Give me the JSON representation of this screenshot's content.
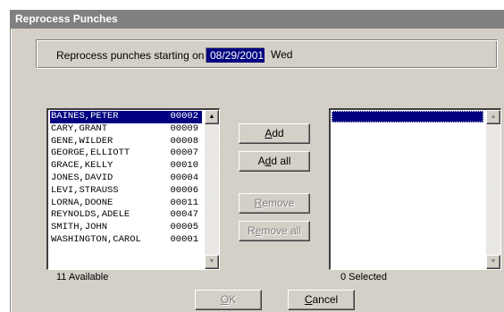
{
  "window": {
    "title": "Reprocess Punches"
  },
  "start": {
    "label": "Reprocess punches starting on",
    "date": "08/29/2001",
    "day": "Wed"
  },
  "available": {
    "items": [
      {
        "name": "BAINES,PETER",
        "id": "00002",
        "selected": true
      },
      {
        "name": "CARY,GRANT",
        "id": "00009"
      },
      {
        "name": "GENE,WILDER",
        "id": "00008"
      },
      {
        "name": "GEORGE,ELLIOTT",
        "id": "00007"
      },
      {
        "name": "GRACE,KELLY",
        "id": "00010"
      },
      {
        "name": "JONES,DAVID",
        "id": "00004"
      },
      {
        "name": "LEVI,STRAUSS",
        "id": "00006"
      },
      {
        "name": "LORNA,DOONE",
        "id": "00011"
      },
      {
        "name": "REYNOLDS,ADELE",
        "id": "00047"
      },
      {
        "name": "SMITH,JOHN",
        "id": "00005"
      },
      {
        "name": "WASHINGTON,CAROL",
        "id": "00001"
      }
    ],
    "count_label": "11 Available"
  },
  "selected": {
    "items": [],
    "count_label": "0 Selected"
  },
  "buttons": {
    "add": {
      "pre": "",
      "key": "A",
      "post": "dd"
    },
    "add_all": {
      "pre": "A",
      "key": "d",
      "post": "d all"
    },
    "remove": {
      "pre": "",
      "key": "R",
      "post": "emove"
    },
    "remove_all": {
      "pre": "R",
      "key": "e",
      "post": "move all"
    },
    "ok": {
      "pre": "",
      "key": "O",
      "post": "K"
    },
    "cancel": {
      "pre": "",
      "key": "C",
      "post": "ancel"
    }
  },
  "colors": {
    "title_bar": "#808080",
    "selection": "#000080",
    "face": "#d4d0c8"
  },
  "icons": {
    "scroll_up": "scroll-up-arrow-icon",
    "scroll_down": "scroll-down-arrow-icon"
  }
}
